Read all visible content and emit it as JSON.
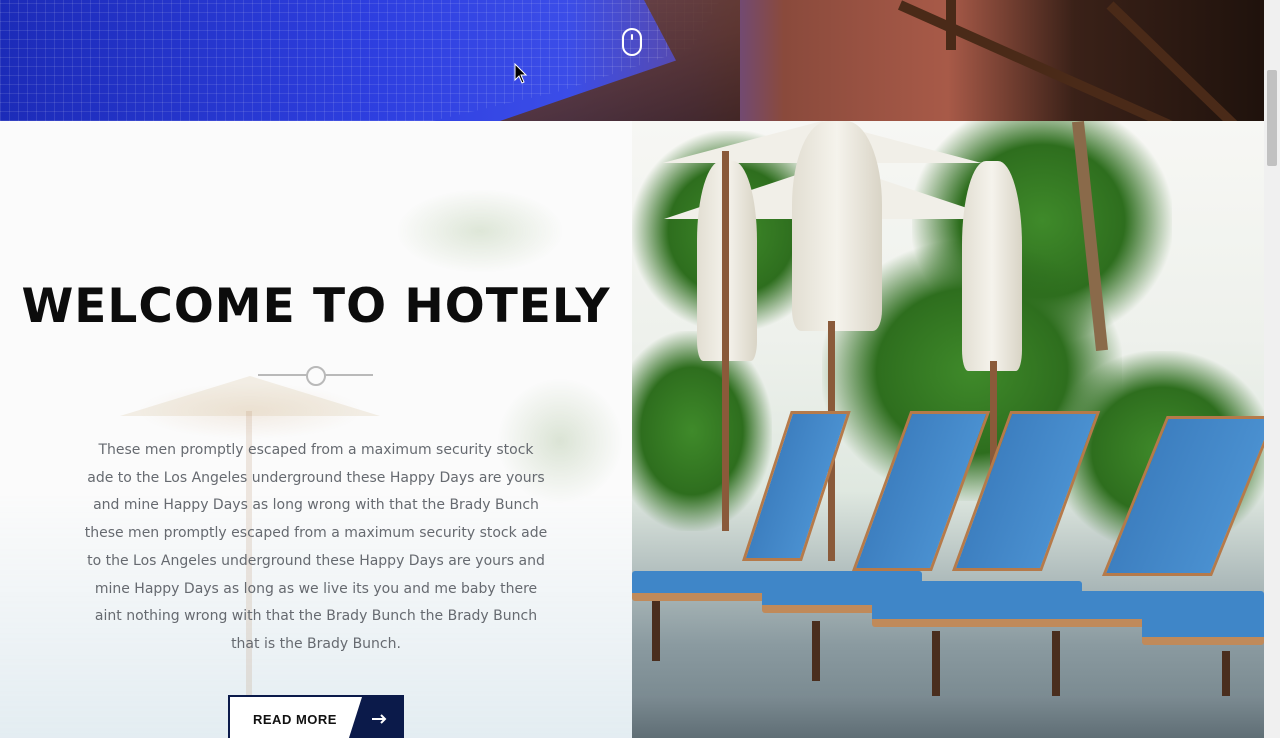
{
  "welcome": {
    "title": "WELCOME TO HOTELY",
    "body": "These men promptly escaped from a maximum security stock ade to the Los Angeles underground these Happy Days are yours and mine Happy Days as long wrong with that the Brady Bunch these men promptly escaped from a maximum security stock ade to the Los Angeles underground these Happy Days are yours and mine Happy Days as long as we live its you and me baby there aint nothing wrong with that the Brady Bunch the Brady Bunch that is the Brady Bunch.",
    "button_label": "READ MORE",
    "button_icon": "arrow-right-icon"
  },
  "hero": {
    "scroll_indicator_icon": "mouse-scroll-icon",
    "cursor_icon": "mouse-pointer-icon"
  },
  "colors": {
    "accent": "#0b1a4a",
    "title": "#0c0c0c",
    "body_text": "#666a70",
    "divider": "#b9b9b9"
  }
}
